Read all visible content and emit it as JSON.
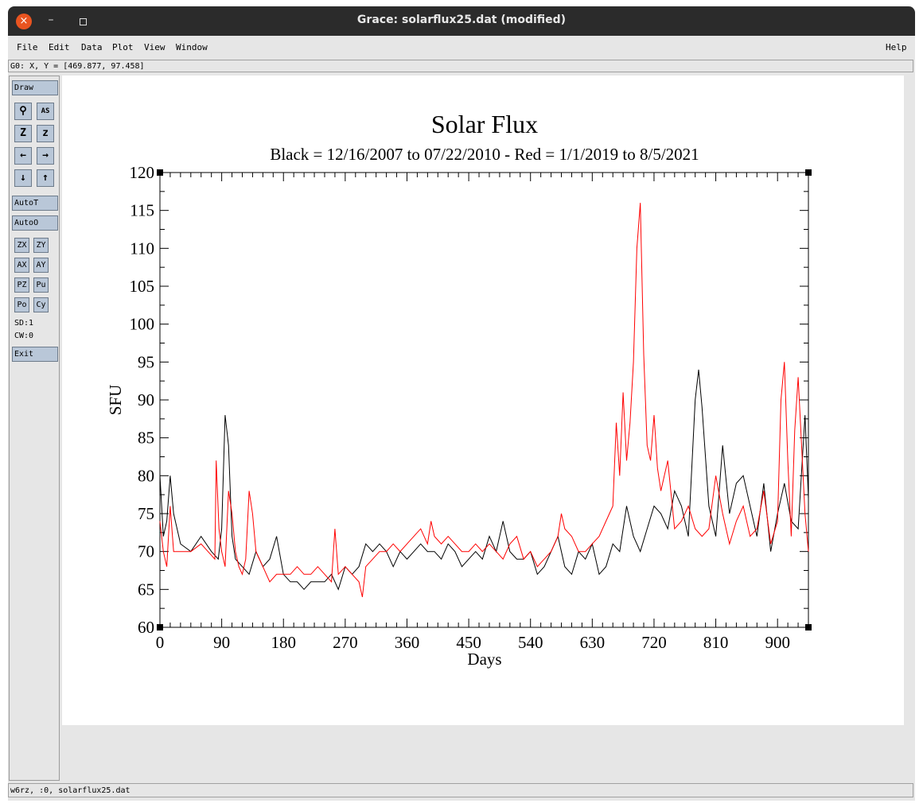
{
  "window": {
    "title": "Grace: solarflux25.dat (modified)",
    "close_glyph": "×",
    "min_glyph": "–"
  },
  "menu": {
    "file": "File",
    "edit": "Edit",
    "data": "Data",
    "plot": "Plot",
    "view": "View",
    "window": "Window",
    "help": "Help"
  },
  "locator": "G0: X, Y = [469.877, 97.458]",
  "toolbar": {
    "draw": "Draw",
    "zoom_glyph": "⚲",
    "autoscale_glyph": "AS",
    "zoom_in_glyph": "Z",
    "zoom_out_glyph": "z",
    "left_glyph": "←",
    "right_glyph": "→",
    "down_glyph": "↓",
    "up_glyph": "↑",
    "autot": "AutoT",
    "autoo": "AutoO",
    "zx": "ZX",
    "zy": "ZY",
    "ax": "AX",
    "ay": "AY",
    "pz": "PZ",
    "pu": "Pu",
    "po": "Po",
    "cy": "Cy",
    "sd": "SD:1",
    "cw": "CW:0",
    "exit": "Exit"
  },
  "status": "w6rz, :0, solarflux25.dat",
  "chart_data": {
    "type": "line",
    "title": "Solar Flux",
    "subtitle": "Black = 12/16/2007 to 07/22/2010 - Red = 1/1/2019 to 8/5/2021",
    "xlabel": "Days",
    "ylabel": "SFU",
    "xlim": [
      0,
      945
    ],
    "ylim": [
      60,
      120
    ],
    "xticks": [
      0,
      90,
      180,
      270,
      360,
      450,
      540,
      630,
      720,
      810,
      900
    ],
    "yticks": [
      60,
      65,
      70,
      75,
      80,
      85,
      90,
      95,
      100,
      105,
      110,
      115,
      120
    ],
    "series": [
      {
        "color": "#000000",
        "x": [
          0,
          5,
          10,
          15,
          20,
          30,
          45,
          60,
          75,
          85,
          90,
          95,
          100,
          105,
          110,
          120,
          130,
          140,
          150,
          160,
          170,
          180,
          190,
          200,
          210,
          220,
          230,
          240,
          250,
          260,
          270,
          280,
          290,
          300,
          310,
          320,
          330,
          340,
          350,
          360,
          370,
          380,
          390,
          400,
          410,
          420,
          430,
          440,
          450,
          460,
          470,
          480,
          490,
          500,
          510,
          520,
          530,
          540,
          550,
          560,
          570,
          580,
          590,
          600,
          610,
          620,
          630,
          640,
          650,
          660,
          670,
          680,
          690,
          700,
          710,
          720,
          730,
          740,
          750,
          760,
          770,
          780,
          785,
          790,
          800,
          810,
          820,
          830,
          840,
          850,
          860,
          870,
          880,
          890,
          900,
          910,
          920,
          930,
          940,
          945
        ],
        "values": [
          80,
          72,
          74,
          80,
          75,
          71,
          70,
          72,
          70,
          69,
          73,
          88,
          84,
          72,
          69,
          68,
          67,
          70,
          68,
          69,
          72,
          67,
          66,
          66,
          65,
          66,
          66,
          66,
          67,
          65,
          68,
          67,
          68,
          71,
          70,
          71,
          70,
          68,
          70,
          69,
          70,
          71,
          70,
          70,
          69,
          71,
          70,
          68,
          69,
          70,
          69,
          72,
          70,
          74,
          70,
          69,
          69,
          70,
          67,
          68,
          70,
          72,
          68,
          67,
          70,
          69,
          71,
          67,
          68,
          71,
          70,
          76,
          72,
          70,
          73,
          76,
          75,
          73,
          78,
          76,
          72,
          90,
          94,
          89,
          76,
          72,
          84,
          75,
          79,
          80,
          76,
          72,
          79,
          70,
          75,
          79,
          74,
          73,
          88,
          77
        ]
      },
      {
        "color": "#ff0000",
        "x": [
          0,
          5,
          10,
          15,
          20,
          30,
          45,
          60,
          70,
          80,
          82,
          86,
          90,
          95,
          100,
          105,
          110,
          115,
          120,
          125,
          130,
          135,
          140,
          150,
          160,
          170,
          180,
          190,
          200,
          210,
          220,
          230,
          240,
          250,
          255,
          260,
          270,
          280,
          290,
          295,
          300,
          310,
          320,
          330,
          340,
          350,
          360,
          370,
          380,
          390,
          395,
          400,
          410,
          420,
          430,
          440,
          450,
          460,
          470,
          480,
          490,
          500,
          510,
          520,
          530,
          540,
          550,
          560,
          570,
          580,
          585,
          590,
          600,
          610,
          620,
          630,
          640,
          650,
          660,
          665,
          670,
          675,
          680,
          685,
          690,
          695,
          700,
          705,
          710,
          715,
          720,
          725,
          730,
          740,
          750,
          760,
          770,
          780,
          790,
          800,
          810,
          820,
          830,
          840,
          850,
          860,
          870,
          880,
          890,
          900,
          905,
          910,
          915,
          920,
          925,
          930,
          935,
          940,
          945
        ],
        "values": [
          74,
          70,
          68,
          76,
          70,
          70,
          70,
          71,
          70,
          69,
          82,
          73,
          70,
          68,
          78,
          75,
          70,
          68,
          67,
          69,
          78,
          75,
          70,
          68,
          66,
          67,
          67,
          67,
          68,
          67,
          67,
          68,
          67,
          66,
          73,
          67,
          68,
          67,
          66,
          64,
          68,
          69,
          70,
          70,
          71,
          70,
          71,
          72,
          73,
          71,
          74,
          72,
          71,
          72,
          71,
          70,
          70,
          71,
          70,
          71,
          70,
          69,
          71,
          72,
          69,
          70,
          68,
          69,
          70,
          72,
          75,
          73,
          72,
          70,
          70,
          71,
          72,
          74,
          76,
          87,
          80,
          91,
          82,
          87,
          95,
          110,
          116,
          96,
          84,
          82,
          88,
          81,
          78,
          82,
          73,
          74,
          76,
          73,
          72,
          73,
          80,
          75,
          71,
          74,
          76,
          72,
          73,
          78,
          71,
          74,
          90,
          95,
          82,
          72,
          86,
          93,
          84,
          75,
          70
        ]
      }
    ]
  }
}
